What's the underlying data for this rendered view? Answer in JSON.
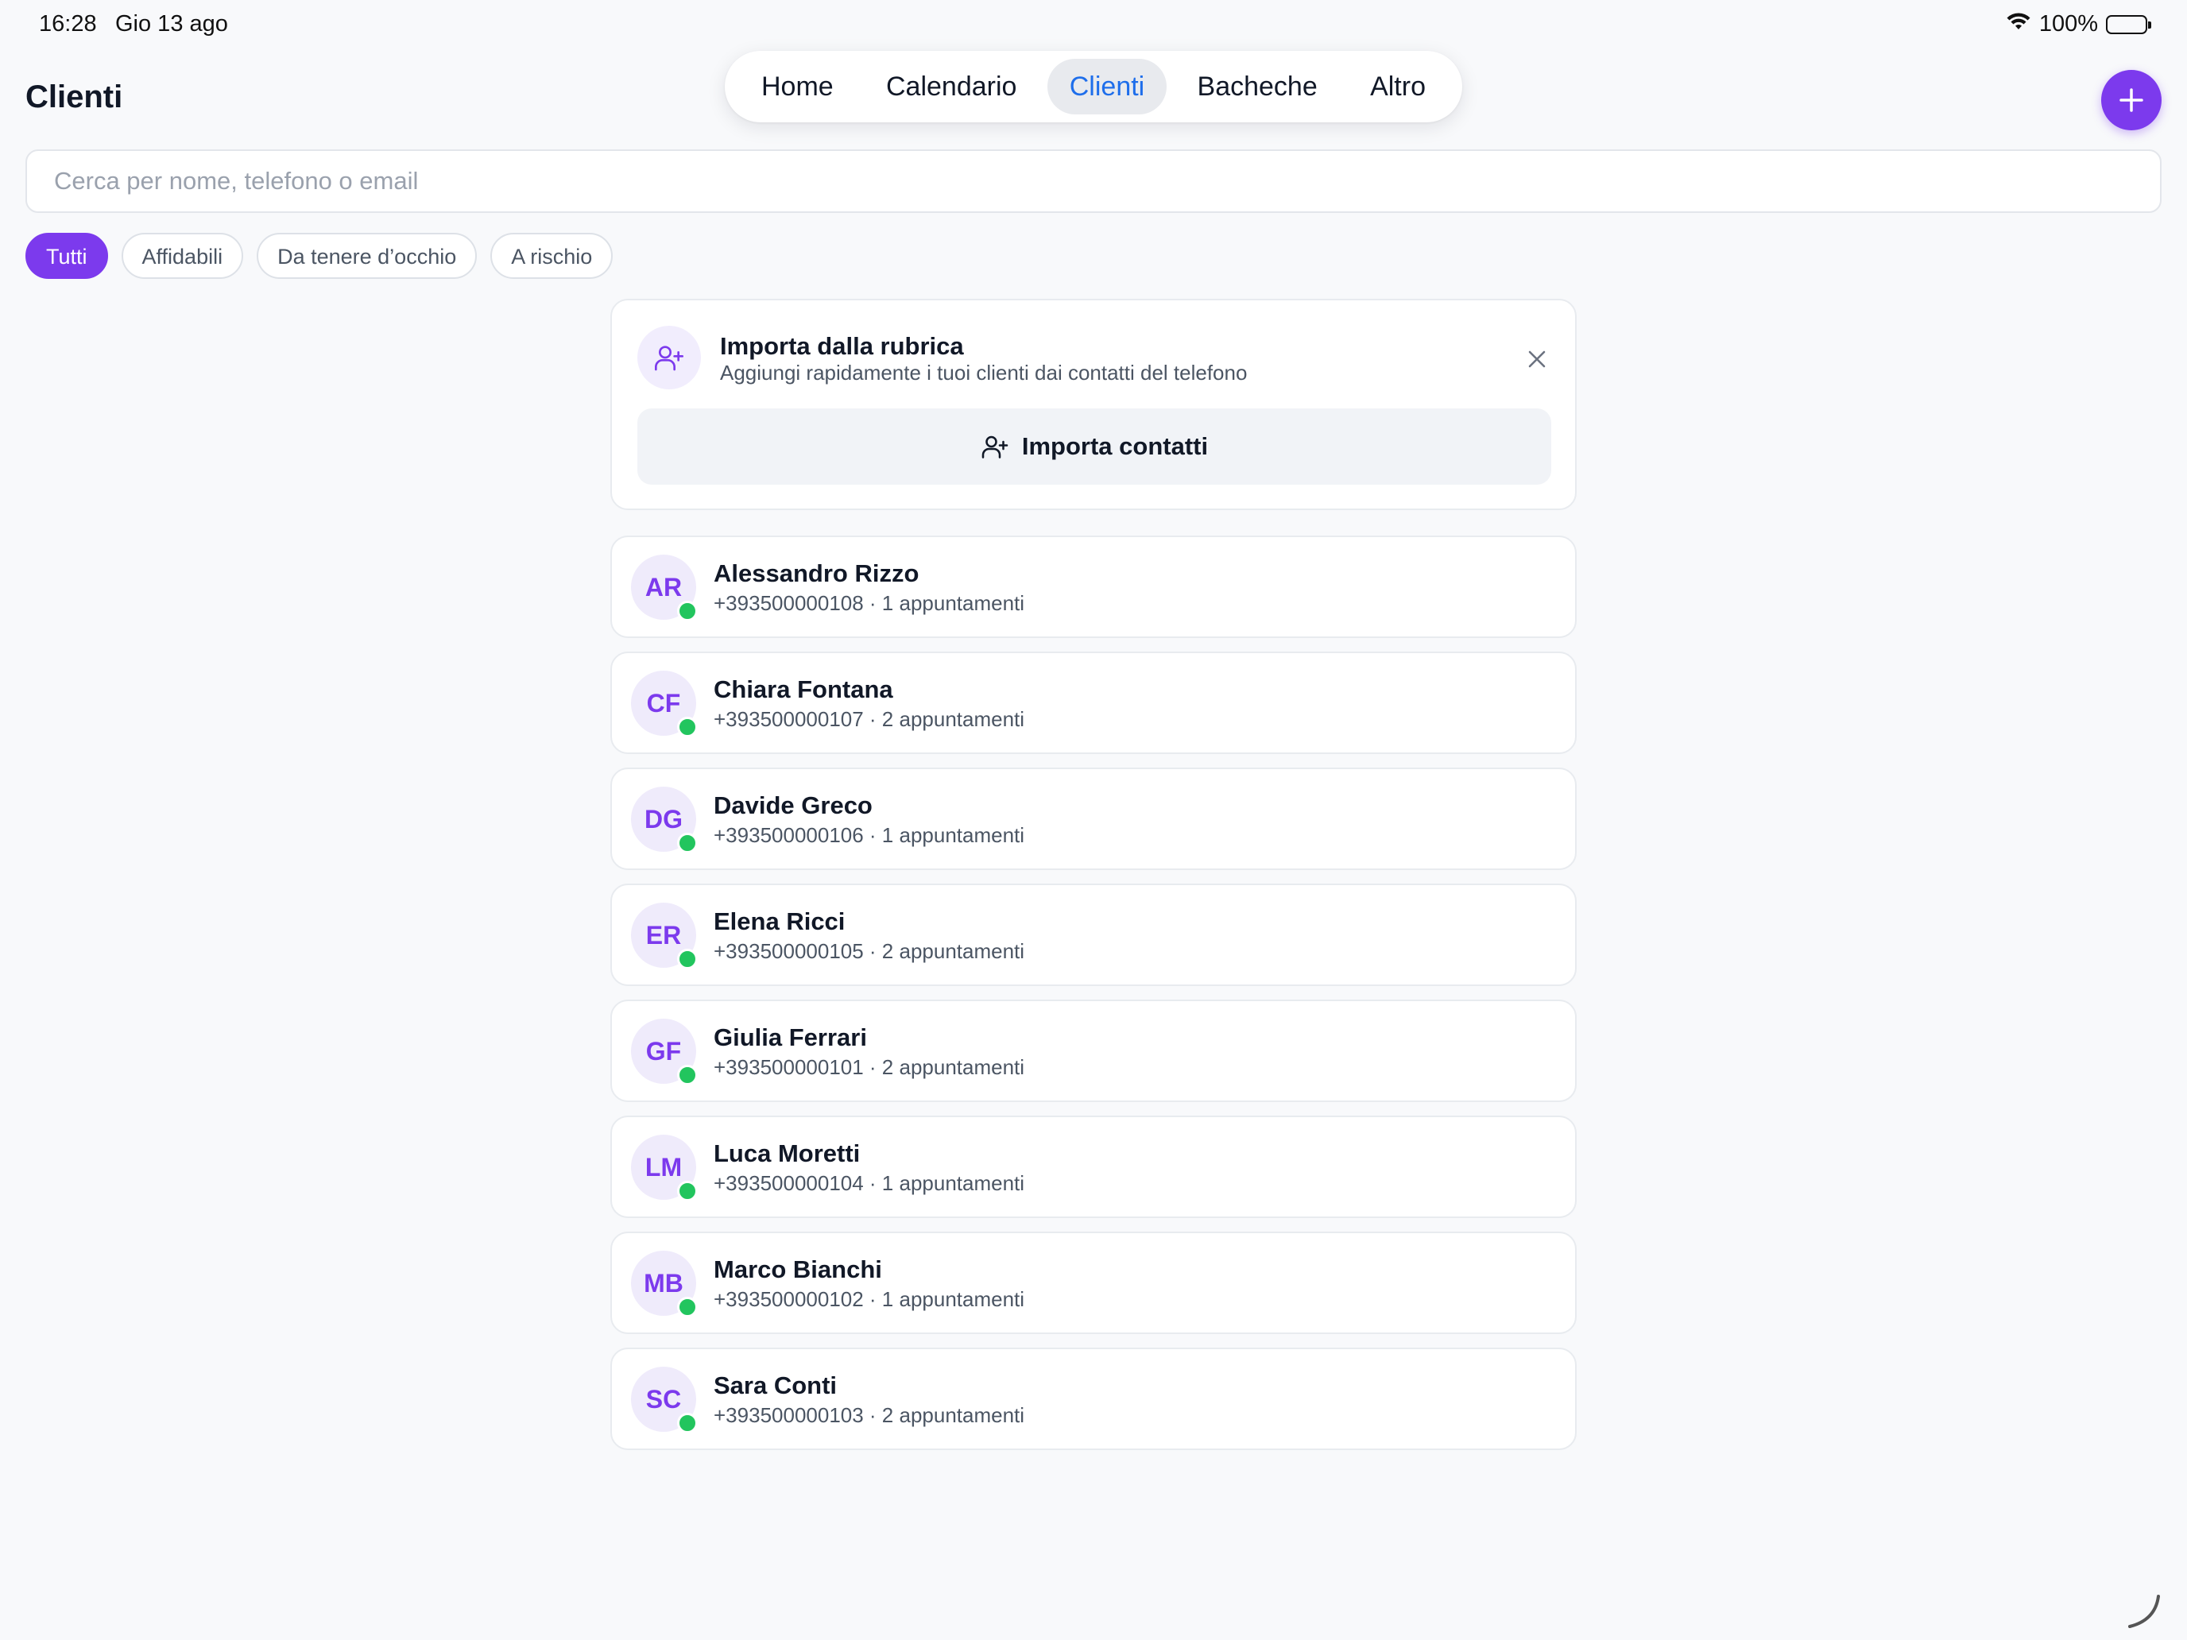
{
  "status_bar": {
    "time": "16:28",
    "date": "Gio 13 ago",
    "battery": "100%",
    "wifi_icon": "wifi-icon",
    "battery_icon": "battery-icon"
  },
  "header": {
    "title": "Clienti"
  },
  "tabs": [
    {
      "label": "Home",
      "active": false
    },
    {
      "label": "Calendario",
      "active": false
    },
    {
      "label": "Clienti",
      "active": true
    },
    {
      "label": "Bacheche",
      "active": false
    },
    {
      "label": "Altro",
      "active": false
    }
  ],
  "search": {
    "placeholder": "Cerca per nome, telefono o email",
    "value": ""
  },
  "filters": [
    {
      "label": "Tutti",
      "active": true
    },
    {
      "label": "Affidabili",
      "active": false
    },
    {
      "label": "Da tenere d’occhio",
      "active": false
    },
    {
      "label": "A rischio",
      "active": false
    }
  ],
  "import_card": {
    "title": "Importa dalla rubrica",
    "subtitle": "Aggiungi rapidamente i tuoi clienti dai contatti del telefono",
    "button_label": "Importa contatti",
    "icon": "user-plus-icon"
  },
  "clients": [
    {
      "initials": "AR",
      "name": "Alessandro Rizzo",
      "meta": "+393500000108 · 1 appuntamenti"
    },
    {
      "initials": "CF",
      "name": "Chiara Fontana",
      "meta": "+393500000107 · 2 appuntamenti"
    },
    {
      "initials": "DG",
      "name": "Davide Greco",
      "meta": "+393500000106 · 1 appuntamenti"
    },
    {
      "initials": "ER",
      "name": "Elena Ricci",
      "meta": "+393500000105 · 2 appuntamenti"
    },
    {
      "initials": "GF",
      "name": "Giulia Ferrari",
      "meta": "+393500000101 · 2 appuntamenti"
    },
    {
      "initials": "LM",
      "name": "Luca Moretti",
      "meta": "+393500000104 · 1 appuntamenti"
    },
    {
      "initials": "MB",
      "name": "Marco Bianchi",
      "meta": "+393500000102 · 1 appuntamenti"
    },
    {
      "initials": "SC",
      "name": "Sara Conti",
      "meta": "+393500000103 · 2 appuntamenti"
    }
  ],
  "colors": {
    "accent": "#7C3AED",
    "active_tab_text": "#1E6EEB",
    "status_online": "#22C55E",
    "background": "#F8F9FB"
  }
}
